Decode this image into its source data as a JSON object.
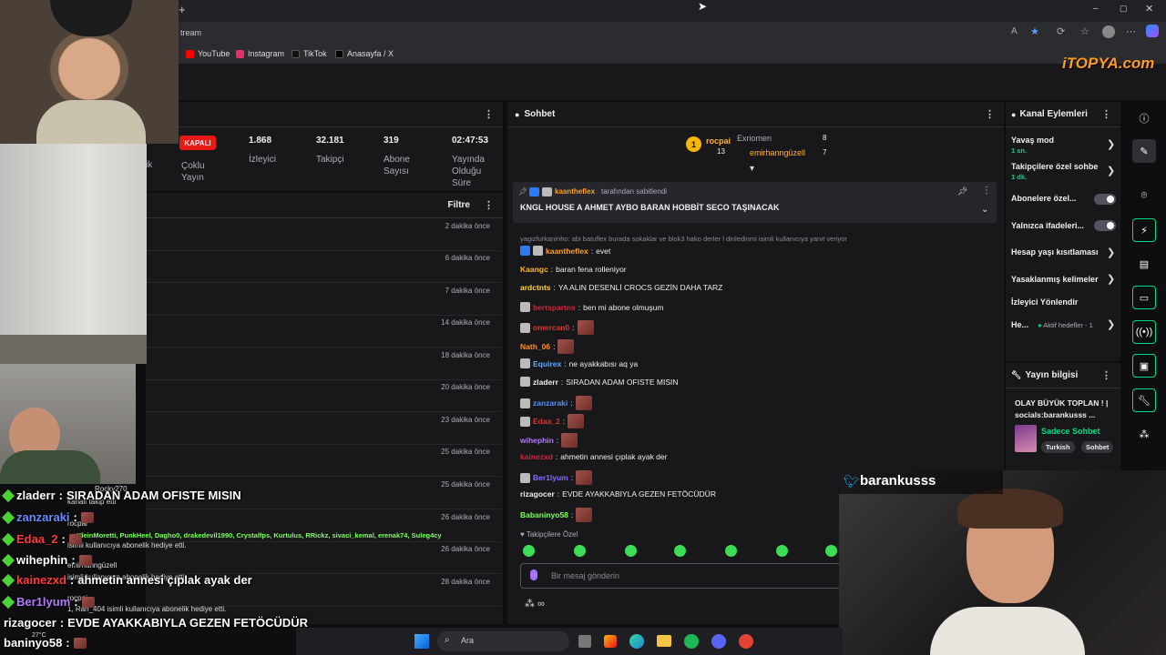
{
  "browser": {
    "address_text": "tream",
    "bookmarks": [
      {
        "label": "YouTube",
        "color": "#ff0000",
        "icon": "youtube-icon"
      },
      {
        "label": "Instagram",
        "color": "#e1306c",
        "icon": "instagram-icon"
      },
      {
        "label": "TikTok",
        "color": "#111111",
        "icon": "tiktok-icon"
      },
      {
        "label": "Anasayfa / X",
        "color": "#000000",
        "icon": "x-icon"
      }
    ],
    "watermark": "iTOPYA.com"
  },
  "stats": {
    "status_label": "KAPALI",
    "multi_stream_label": "Çoklu Yayın",
    "partial_label": "ik",
    "items": [
      {
        "value": "1.868",
        "label": "İzleyici"
      },
      {
        "value": "32.181",
        "label": "Takipçi"
      },
      {
        "value": "319",
        "label": "Abone Sayısı"
      },
      {
        "value": "02:47:53",
        "label": "Yayında Olduğu Süre"
      }
    ]
  },
  "activity": {
    "filter_label": "Filtre",
    "times": [
      "2 dakika önce",
      "6 dakika önce",
      "7 dakika önce",
      "14 dakika önce",
      "18 dakika önce",
      "20 dakika önce",
      "23 dakika önce",
      "25 dakika önce",
      "25 dakika önce",
      "26 dakika önce",
      "26 dakika önce",
      "28 dakika önce"
    ]
  },
  "chat": {
    "title": "Sohbet",
    "leaderboard": {
      "rank": "1",
      "top_user": "rocpai",
      "top_count": "13",
      "users": [
        {
          "name": "Exriomen",
          "count": "8"
        },
        {
          "name": "emirhanngüzell",
          "count": "7"
        }
      ]
    },
    "pinned": {
      "by_user": "kaantheflex",
      "by_suffix": "tarafından sabitlendi",
      "text": "KNGL HOUSE A AHMET AYBO BARAN HOBBİT SECO TAŞINACAK"
    },
    "reply_context": "yagizfurkaninho: abi batuflex burada sokaklar ve blok3 hako derler l dinledinmi isimli kullanıcıya yanıt veriyor",
    "messages": [
      {
        "user": "kaantheflex",
        "color": "#ff9f1a",
        "text": "evet",
        "emote": false
      },
      {
        "user": "Kaangc",
        "color": "#ffb32b",
        "text": "baran fena rolleniyor",
        "emote": false
      },
      {
        "user": "ardctnts",
        "color": "#ffd24a",
        "text": "YA ALIN DESENLİ CROCS GEZİN DAHA TARZ",
        "emote": false
      },
      {
        "user": "bertspartns",
        "color": "#d1243b",
        "text": "ben mi abone olmuşum",
        "emote": false
      },
      {
        "user": "omercan0",
        "color": "#e0312a",
        "text": "",
        "emote": true
      },
      {
        "user": "Nath_06",
        "color": "#ff8c2b",
        "text": "",
        "emote": true
      },
      {
        "user": "Equirex",
        "color": "#5aa9ff",
        "text": "ne ayakkabısı aq ya",
        "emote": false
      },
      {
        "user": "zladerr",
        "color": "#efeff1",
        "text": "SIRADAN ADAM OFISTE MISIN",
        "emote": false
      },
      {
        "user": "zanzaraki",
        "color": "#5a8fff",
        "text": "",
        "emote": true
      },
      {
        "user": "Edaa_2",
        "color": "#e0312a",
        "text": "",
        "emote": true
      },
      {
        "user": "wihephin",
        "color": "#b57bff",
        "text": "",
        "emote": true
      },
      {
        "user": "kainezxd",
        "color": "#d1243b",
        "text": "ahmetin annesi çıplak ayak der",
        "emote": false
      },
      {
        "user": "Ber1lyum",
        "color": "#8a6bff",
        "text": "",
        "emote": true
      },
      {
        "user": "rizagocer",
        "color": "#efeff1",
        "text": "EVDE AYAKKABIYLA GEZEN FETÖCÜDÜR",
        "emote": false
      },
      {
        "user": "Babaninyo58",
        "color": "#7bff5a",
        "text": "",
        "emote": true
      }
    ],
    "followers_only_label": "Takipçilere Özel",
    "input_placeholder": "Bir mesaj gönderin"
  },
  "channel_actions": {
    "title": "Kanal Eylemleri",
    "items": [
      {
        "label": "Yavaş mod",
        "sub": "1 sn.",
        "control": "chevron"
      },
      {
        "label": "Takipçilere özel sohbe",
        "sub": "1 dk.",
        "control": "chevron"
      },
      {
        "label": "Abonelere özel...",
        "sub": "",
        "control": "toggle"
      },
      {
        "label": "Yalnızca ifadeleri...",
        "sub": "",
        "control": "toggle"
      },
      {
        "label": "Hesap yaşı kısıtlaması",
        "sub": "",
        "control": "chevron"
      },
      {
        "label": "Yasaklanmış kelimeler",
        "sub": "",
        "control": "chevron"
      },
      {
        "label": "İzleyici Yönlendir",
        "sub": "",
        "control": "none"
      },
      {
        "label": "He...",
        "sub": "",
        "control": "chevron",
        "extra": "Aktif hedefler - 1"
      }
    ]
  },
  "stream_info": {
    "title": "Yayın bilgisi",
    "stream_title": "OLAY BÜYÜK TOPLAN ! | socials:barankusss ...",
    "category": "Sadece Sohbet",
    "tags": [
      "Turkish",
      "Sohbet"
    ]
  },
  "overlay": {
    "channel_name": "barankusss",
    "messages": [
      {
        "user": "zladerr",
        "color": "#ffffff",
        "text": "SIRADAN ADAM OFISTE MISIN",
        "emote": false
      },
      {
        "user": "zanzaraki",
        "color": "#6b8cff",
        "text": "",
        "emote": true
      },
      {
        "user": "Edaa_2",
        "color": "#ff3b3b",
        "text": "",
        "emote": true
      },
      {
        "user": "wihephin",
        "color": "#ffffff",
        "text": "",
        "emote": true
      },
      {
        "user": "kainezxd",
        "color": "#ff3b3b",
        "text": "ahmetin annesi çıplak ayak der",
        "emote": false
      },
      {
        "user": "Ber1lyum",
        "color": "#b57bff",
        "text": "",
        "emote": true
      },
      {
        "user": "rizagocer",
        "color": "#ffffff",
        "text": "EVDE AYAKKABIYLA GEZEN FETÖCÜDÜR",
        "emote": false
      },
      {
        "user": "baninyo58",
        "color": "#ffffff",
        "text": "",
        "emote": true
      }
    ],
    "ghost_lines": [
      "Rocky270",
      "kanalı takip etti",
      "rocpai",
      "KleinMoretti, PunkHeel, Dagho0, drakedevil1990, Crystalfps, Kurtulus, RRickz, sivaci_kemal, erenak74, Suleg4cy",
      "isimli kullanıcıya abonelik hediye etti.",
      "emirhanngüzell",
      "isimli kullanıcıya abonelik hediye etti.",
      "rocpai",
      "1, Ran_404 isimli kullanıcıya abonelik hediye etti."
    ]
  },
  "taskbar": {
    "search_label": "Ara",
    "weather": "27°C"
  },
  "colors": {
    "accent_green": "#00db84",
    "danger": "#e91916",
    "panel": "#18181b",
    "background": "#0e0e10"
  }
}
